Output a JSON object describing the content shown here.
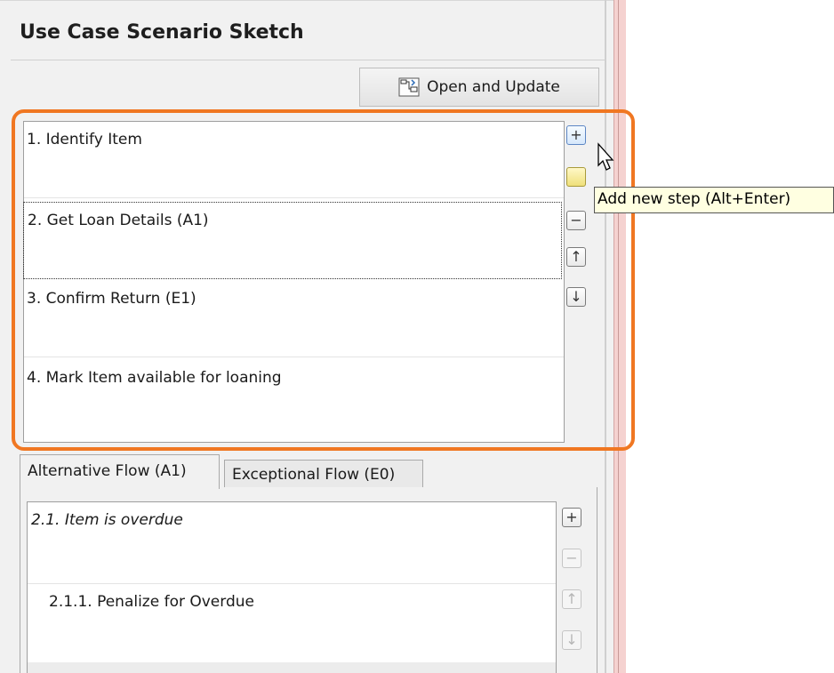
{
  "title": "Use Case Scenario Sketch",
  "open_update": {
    "label": "Open and Update",
    "icon": "diagram-update-icon"
  },
  "steps": [
    {
      "label": "1. Identify Item"
    },
    {
      "label": "2. Get Loan Details (A1)",
      "selected": true
    },
    {
      "label": "3. Confirm Return (E1)"
    },
    {
      "label": "4. Mark Item available for loaning"
    }
  ],
  "step_buttons": {
    "add": "+",
    "remove": "−",
    "up": "↑",
    "down": "↓"
  },
  "tooltip": "Add new step (Alt+Enter)",
  "tabs": [
    {
      "label": "Alternative Flow (A1)",
      "active": true
    },
    {
      "label": "Exceptional Flow (E0)",
      "active": false
    }
  ],
  "flow_rows": [
    {
      "label": "2.1. Item is overdue",
      "italic": true
    },
    {
      "label": "2.1.1. Penalize for Overdue",
      "italic": false
    }
  ],
  "colors": {
    "highlight": "#f07722",
    "tooltip_bg": "#ffffe1",
    "side_strip": "#f5d2d0"
  }
}
